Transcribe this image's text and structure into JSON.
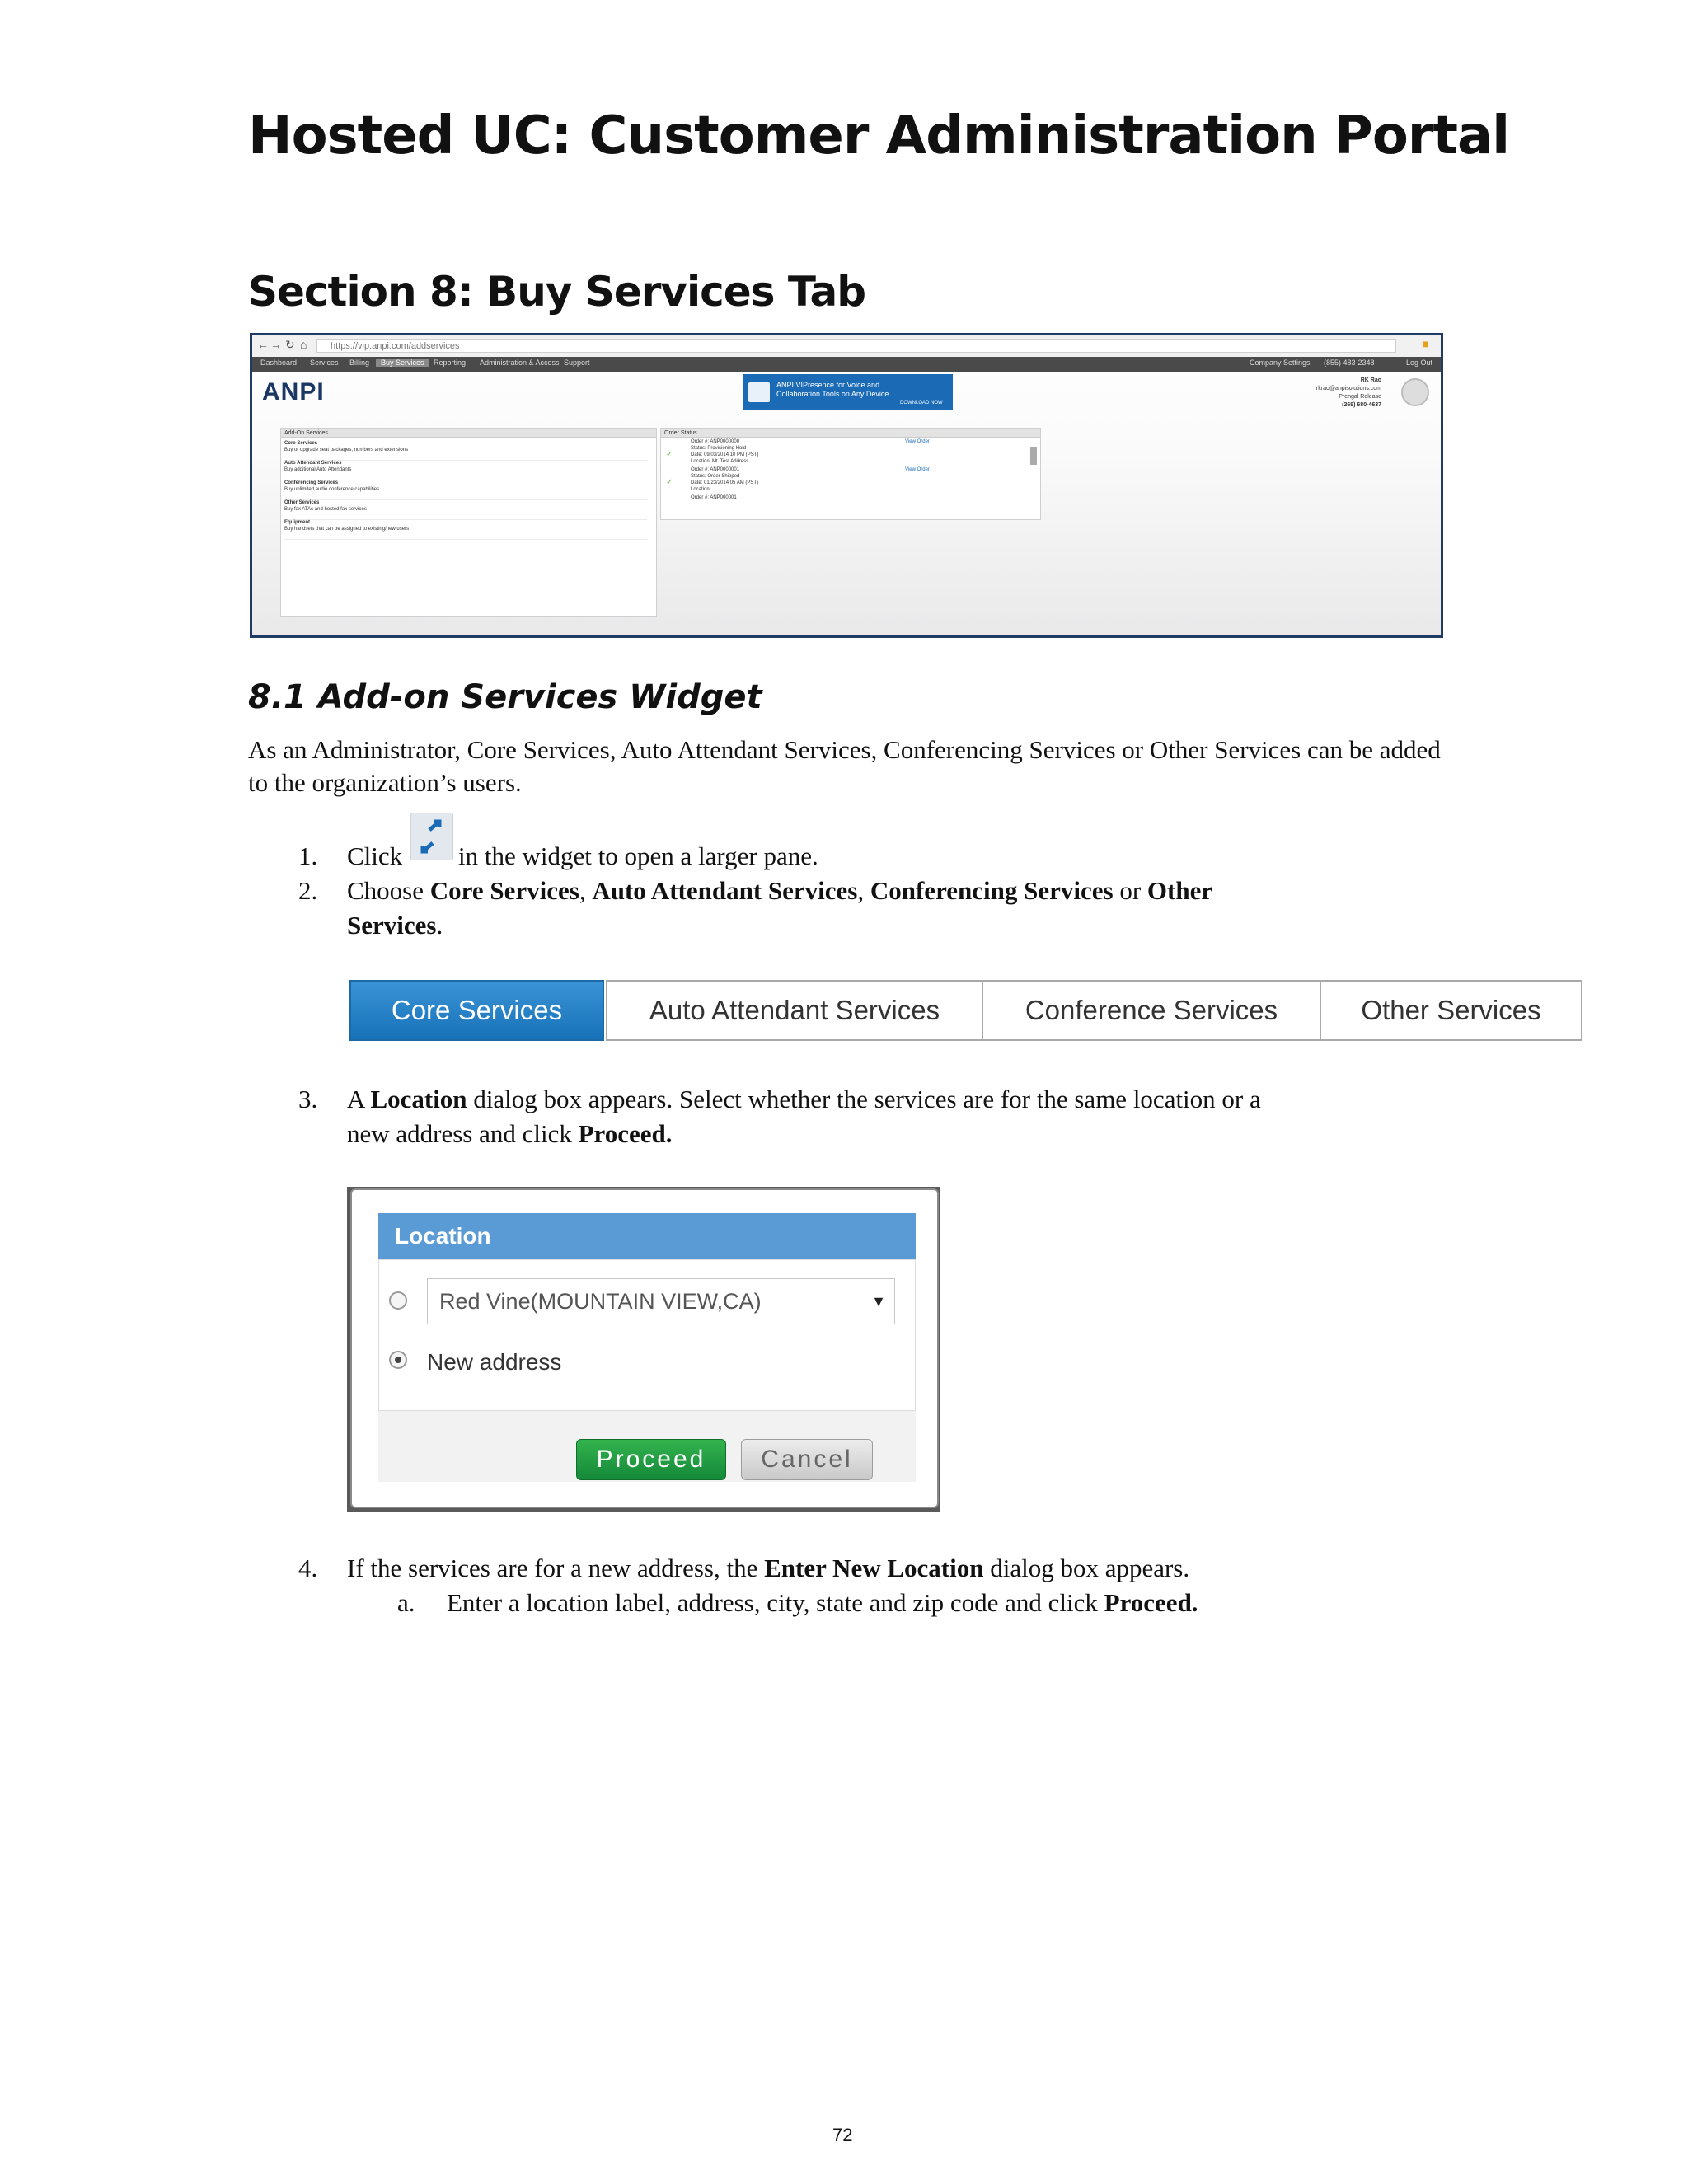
{
  "document": {
    "title": "Hosted UC: Customer Administration Portal",
    "section_title": "Section 8: Buy Services Tab",
    "subsection_title": "8.1 Add-on Services Widget",
    "intro": "As an Administrator, Core Services, Auto Attendant Services, Conferencing Services or Other Services can be added to the organization’s users.",
    "page_number": "72"
  },
  "steps": {
    "s1_num": "1.",
    "s1_pre": "Click",
    "s1_post": "in the widget to open a larger pane.",
    "s2_num": "2.",
    "s2_pre": "Choose",
    "s2_b1": "Core Services",
    "s2_sep1": ",",
    "s2_b2": "Auto Attendant Services",
    "s2_sep2": ",",
    "s2_b3": "Conferencing Services",
    "s2_or": "or",
    "s2_b4a": "Other",
    "s2_b4b": "Services",
    "s2_end": ".",
    "s3_num": "3.",
    "s3_pre": "A",
    "s3_b": "Location",
    "s3_mid": "dialog box appears. Select whether the services are for the same location or a",
    "s3_line2": "new address and click",
    "s3_b2": "Proceed.",
    "s4_num": "4.",
    "s4_pre": "If the services are for a new address, the",
    "s4_b": "Enter New Location",
    "s4_post": "dialog box appears.",
    "s4a_num": "a.",
    "s4a_pre": "Enter a location label, address, city, state and zip code and click",
    "s4a_b": "Proceed."
  },
  "tabs": [
    "Core Services",
    "Auto Attendant Services",
    "Conference Services",
    "Other Services"
  ],
  "tabs_active_index": 0,
  "location_dialog": {
    "title": "Location",
    "select_value": "Red Vine(MOUNTAIN VIEW,CA)",
    "new_address_label": "New address",
    "new_address_selected": true,
    "proceed": "Proceed",
    "cancel": "Cancel"
  },
  "portal_screenshot": {
    "url": "https://vip.anpi.com/addservices",
    "menu": [
      "Dashboard",
      "Services",
      "Billing",
      "Buy Services",
      "Reporting",
      "Administration & Access",
      "Support"
    ],
    "menu_right": [
      "Company Settings",
      "(855) 483-2348",
      "Log Out"
    ],
    "logo": "ANPI",
    "banner": [
      "ANPI VIPresence for Voice and",
      "Collaboration Tools on Any Device"
    ],
    "banner_cta": "DOWNLOAD NOW",
    "user": [
      "RK Rao",
      "rkrao@anpisolutions.com",
      "Prengal Release",
      "(269) 680-4637"
    ],
    "addon_title": "Add-On Services",
    "addon_items": [
      {
        "title": "Core Services",
        "desc": "Buy or upgrade seat packages, numbers and extensions"
      },
      {
        "title": "Auto Attendant Services",
        "desc": "Buy additional Auto Attendants"
      },
      {
        "title": "Conferencing Services",
        "desc": "Buy unlimited audio conference capabilities"
      },
      {
        "title": "Other Services",
        "desc": "Buy fax ATAs and hosted fax services"
      },
      {
        "title": "Equipment",
        "desc": "Buy handsets that can be assigned to existing/new users"
      }
    ],
    "order_title": "Order Status",
    "orders": [
      "Order #: ANP0000000",
      "Status: Provisioning Hold",
      "Date: 09/03/2014 10 PM (PST)",
      "Location: Mt. Test Address",
      "Order #: ANP0000001",
      "Status: Order Shipped",
      "Date: 01/23/2014 05 AM (PST)",
      "Location:",
      "Order #: ANP000001"
    ],
    "order_link": "View Order"
  },
  "colors": {
    "tab_active": "#1f7bc1",
    "dialog_header": "#5b9bd5",
    "proceed_button": "#1a9a40",
    "banner": "#1a6ab5",
    "frame_border": "#1f3a63"
  }
}
